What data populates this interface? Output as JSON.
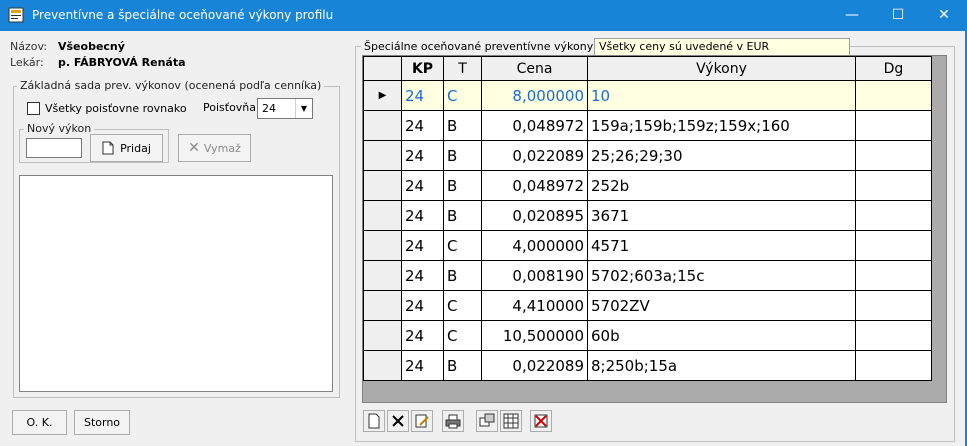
{
  "window": {
    "title": "Preventívne a špeciálne oceňované výkony profilu",
    "minimize": "—",
    "maximize": "☐",
    "close": "✕"
  },
  "profile": {
    "name_label": "Názov:",
    "name_value": "Všeobecný",
    "doctor_label": "Lekár:",
    "doctor_value": "p. FÁBRYOVÁ Renáta"
  },
  "basic_set": {
    "caption": "Základná sada prev. výkonov (ocenená podľa cenníka)",
    "all_insurers_label": "Všetky poisťovne rovnako",
    "insurer_label": "Poisťovňa",
    "insurer_value": "24",
    "new_service_caption": "Nový výkon",
    "new_service_value": "",
    "add_label": "Pridaj",
    "delete_label": "Vymaž"
  },
  "footer": {
    "ok_label": "O. K.",
    "cancel_label": "Storno"
  },
  "special": {
    "caption": "Špeciálne oceňované preventívne výkony",
    "info": "Všetky ceny sú uvedené v EUR",
    "columns": [
      "KP",
      "T",
      "Cena",
      "Výkony",
      "Dg"
    ],
    "rows": [
      {
        "kp": "24",
        "t": "C",
        "cena": "8,000000",
        "vykony": "10",
        "dg": ""
      },
      {
        "kp": "24",
        "t": "B",
        "cena": "0,048972",
        "vykony": "159a;159b;159z;159x;160",
        "dg": ""
      },
      {
        "kp": "24",
        "t": "B",
        "cena": "0,022089",
        "vykony": "25;26;29;30",
        "dg": ""
      },
      {
        "kp": "24",
        "t": "B",
        "cena": "0,048972",
        "vykony": "252b",
        "dg": ""
      },
      {
        "kp": "24",
        "t": "B",
        "cena": "0,020895",
        "vykony": "3671",
        "dg": ""
      },
      {
        "kp": "24",
        "t": "C",
        "cena": "4,000000",
        "vykony": "4571",
        "dg": ""
      },
      {
        "kp": "24",
        "t": "B",
        "cena": "0,008190",
        "vykony": "5702;603a;15c",
        "dg": ""
      },
      {
        "kp": "24",
        "t": "C",
        "cena": "4,410000",
        "vykony": "5702ZV",
        "dg": ""
      },
      {
        "kp": "24",
        "t": "C",
        "cena": "10,500000",
        "vykony": "60b",
        "dg": ""
      },
      {
        "kp": "24",
        "t": "B",
        "cena": "0,022089",
        "vykony": "8;250b;15a",
        "dg": ""
      }
    ]
  },
  "toolbar": [
    "new-record-icon",
    "delete-record-icon",
    "edit-record-icon",
    "print-icon",
    "export-icon",
    "grid-icon",
    "delete-filter-icon"
  ],
  "colors": {
    "titlebar": "#1884d8",
    "selected_row": "#ffffe1",
    "selected_text": "#1a6dd1"
  }
}
